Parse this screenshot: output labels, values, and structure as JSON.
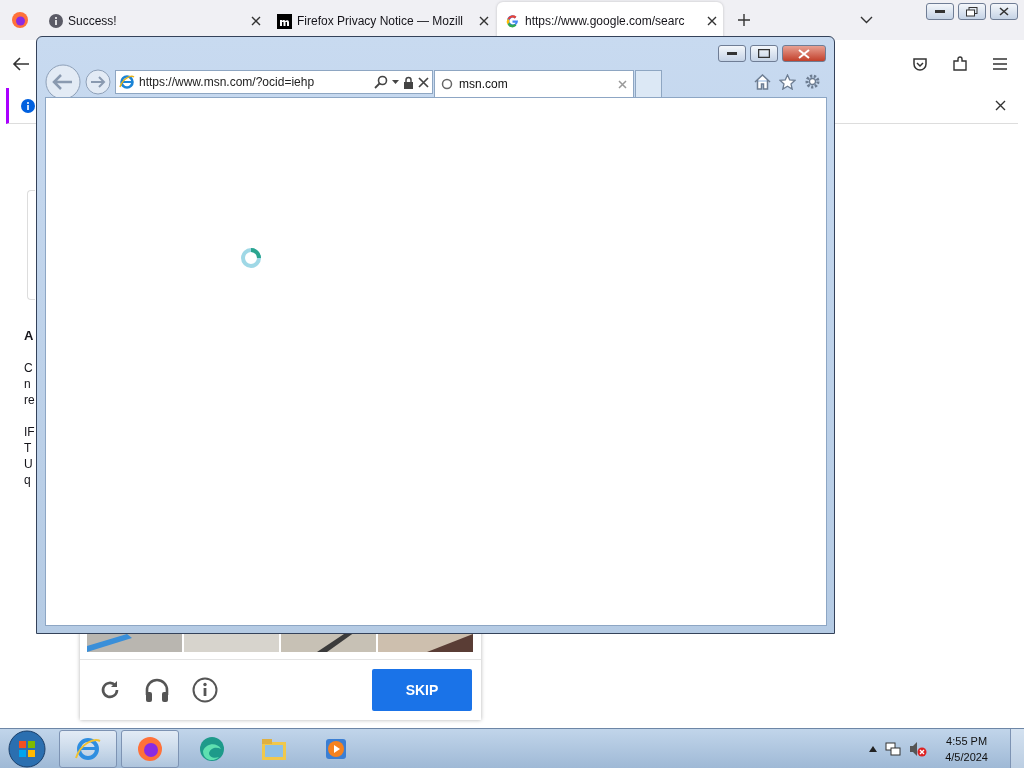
{
  "firefox": {
    "tabs": [
      {
        "title": "Success!",
        "selected": false,
        "kind": "info"
      },
      {
        "title": "Firefox Privacy Notice — Mozill",
        "selected": false,
        "kind": "mozilla"
      },
      {
        "title": "https://www.google.com/searc",
        "selected": true,
        "kind": "google"
      }
    ],
    "page_fragments": {
      "heading": "A",
      "lines_1": [
        "C",
        "n",
        "re"
      ],
      "lines_2": [
        "IF",
        "T",
        "U",
        "q"
      ]
    },
    "captcha": {
      "skip_button": "SKIP"
    }
  },
  "ie": {
    "address": "https://www.msn.com/?ocid=iehp",
    "tabs": [
      {
        "title": "msn.com",
        "selected": true
      }
    ]
  },
  "taskbar": {
    "apps": [
      {
        "kind": "ie",
        "running": true
      },
      {
        "kind": "firefox",
        "running": true
      },
      {
        "kind": "edge",
        "running": false
      },
      {
        "kind": "explorer",
        "running": false
      },
      {
        "kind": "media",
        "running": false
      }
    ],
    "clock_time": "4:55 PM",
    "clock_date": "4/5/2024"
  }
}
